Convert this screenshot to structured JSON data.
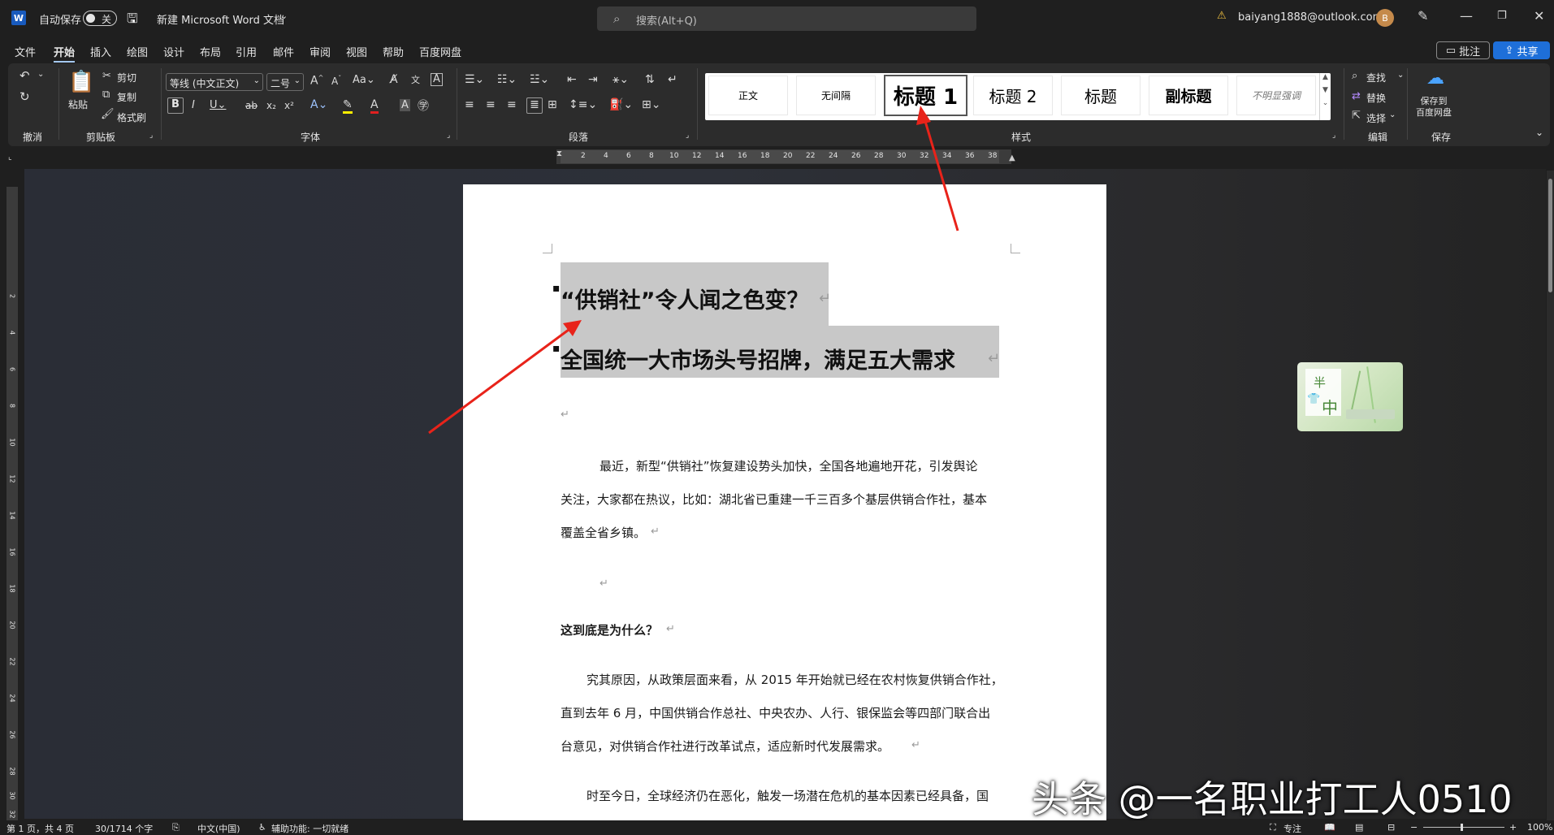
{
  "titlebar": {
    "app_icon": "W",
    "autosave_label": "自动保存",
    "autosave_state": "关",
    "doc_title": "新建 Microsoft Word 文档",
    "search_placeholder": "搜索(Alt+Q)",
    "account": "baiyang1888@outlook.com",
    "avatar": "B"
  },
  "menu": {
    "tabs": [
      "文件",
      "开始",
      "插入",
      "绘图",
      "设计",
      "布局",
      "引用",
      "邮件",
      "审阅",
      "视图",
      "帮助",
      "百度网盘"
    ],
    "active": "开始",
    "comment_btn": "批注",
    "share_btn": "共享"
  },
  "ribbon": {
    "undo_group": "撤消",
    "clipboard": {
      "paste": "粘贴",
      "cut": "剪切",
      "copy": "复制",
      "format_painter": "格式刷",
      "label": "剪贴板"
    },
    "font": {
      "name": "等线 (中文正文)",
      "size": "二号",
      "label": "字体"
    },
    "paragraph": {
      "label": "段落"
    },
    "styles": {
      "items": [
        "正文",
        "无间隔",
        "标题 1",
        "标题 2",
        "标题",
        "副标题",
        "不明显强调"
      ],
      "selected": "标题 1",
      "label": "样式"
    },
    "editing": {
      "find": "查找",
      "replace": "替换",
      "select": "选择",
      "label": "编辑"
    },
    "save": {
      "save_to_baidu": "保存到\n百度网盘",
      "label": "保存"
    }
  },
  "ruler": {
    "h_numbers": [
      "2",
      "4",
      "6",
      "8",
      "10",
      "12",
      "14",
      "16",
      "18",
      "20",
      "22",
      "24",
      "26",
      "28",
      "30",
      "32",
      "34",
      "36",
      "38"
    ],
    "v_numbers": [
      "2",
      "4",
      "6",
      "8",
      "10",
      "12",
      "14",
      "16",
      "18",
      "20",
      "22",
      "24",
      "26",
      "28",
      "30",
      "32"
    ]
  },
  "document": {
    "heading1": "“供销社”令人闻之色变？",
    "heading2": "全国统一大市场头号招牌，满足五大需求",
    "para1_line1": "最近，新型“供销社”恢复建设势头加快，全国各地遍地开花，引发舆论",
    "para1_line2": "关注，大家都在热议，比如：湖北省已重建一千三百多个基层供销合作社，基本",
    "para1_line3": "覆盖全省乡镇。",
    "subheading": "这到底是为什么？",
    "para2_line1": "究其原因，从政策层面来看，从 2015 年开始就已经在农村恢复供销合作社，",
    "para2_line2": "直到去年 6 月，中国供销合作总社、中央农办、人行、银保监会等四部门联合出",
    "para2_line3": "台意见，对供销合作社进行改革试点，适应新时代发展需求。",
    "para3_line1": "时至今日，全球经济仍在恶化，触发一场潜在危机的基本因素已经具备，国",
    "para_mark": "↵"
  },
  "float_image": {
    "chars": [
      "半",
      "中"
    ],
    "label": "半，中"
  },
  "watermark": "头条 @一名职业打工人0510",
  "status": {
    "page": "第 1 页，共 4 页",
    "words": "30/1714 个字",
    "language": "中文(中国)",
    "accessibility": "辅助功能: 一切就绪",
    "focus": "专注",
    "zoom": "100%"
  },
  "colors": {
    "accent": "#185abd",
    "share": "#1e6fd9",
    "annotation_arrow": "#e8231a"
  }
}
